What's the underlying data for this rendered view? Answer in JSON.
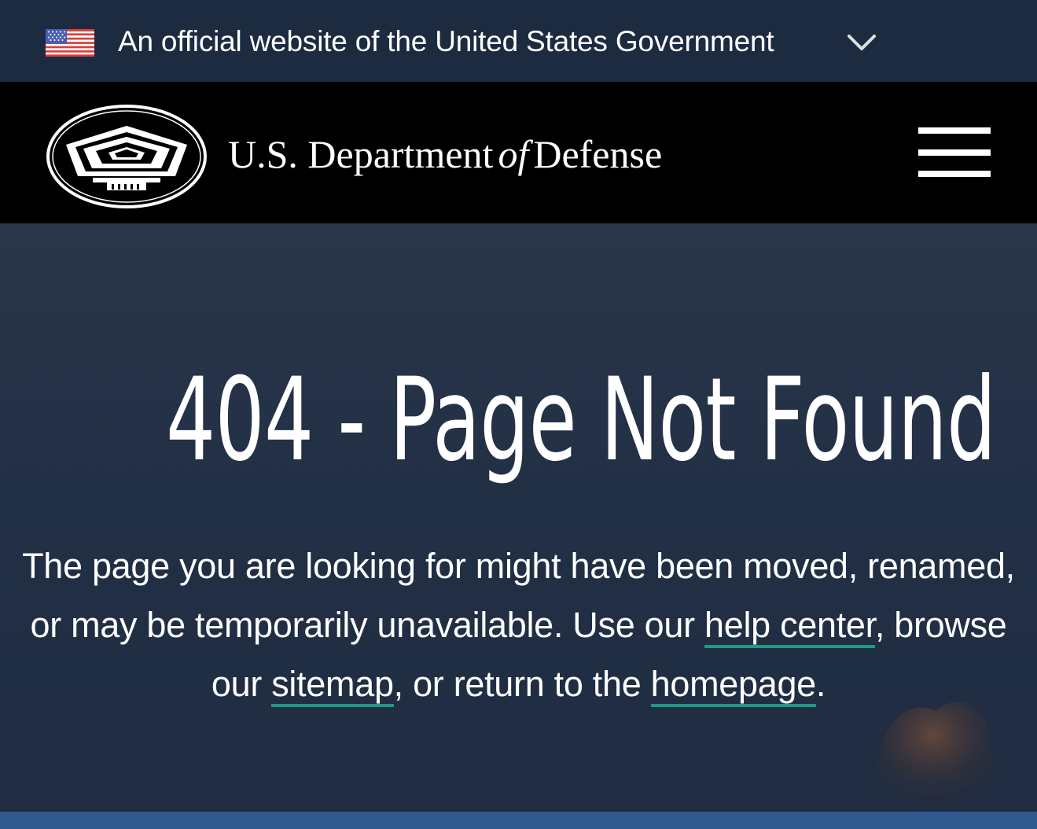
{
  "gov_banner": {
    "text": "An official website of the United States Government",
    "flag_icon": "us-flag-icon",
    "toggle_icon": "chevron-down-icon"
  },
  "header": {
    "logo_icon": "pentagon-seal-icon",
    "title_part1": "U.S. Department",
    "title_of": "of",
    "title_part2": "Defense",
    "menu_icon": "hamburger-menu-icon"
  },
  "error": {
    "heading": "404 - Page Not Found",
    "text_1": "The page you are looking for might have been moved, renamed, or may be temporarily unavailable. Use our ",
    "link_help": "help center",
    "text_2": ", browse our ",
    "link_sitemap": "sitemap",
    "text_3": ", or return to the ",
    "link_homepage": "homepage",
    "text_4": "."
  },
  "colors": {
    "banner_bg": "#1c2b40",
    "header_bg": "#000000",
    "hero_bg": "#223046",
    "link_underline": "#1f9a83",
    "bottom_strip": "#2f5a8f"
  }
}
